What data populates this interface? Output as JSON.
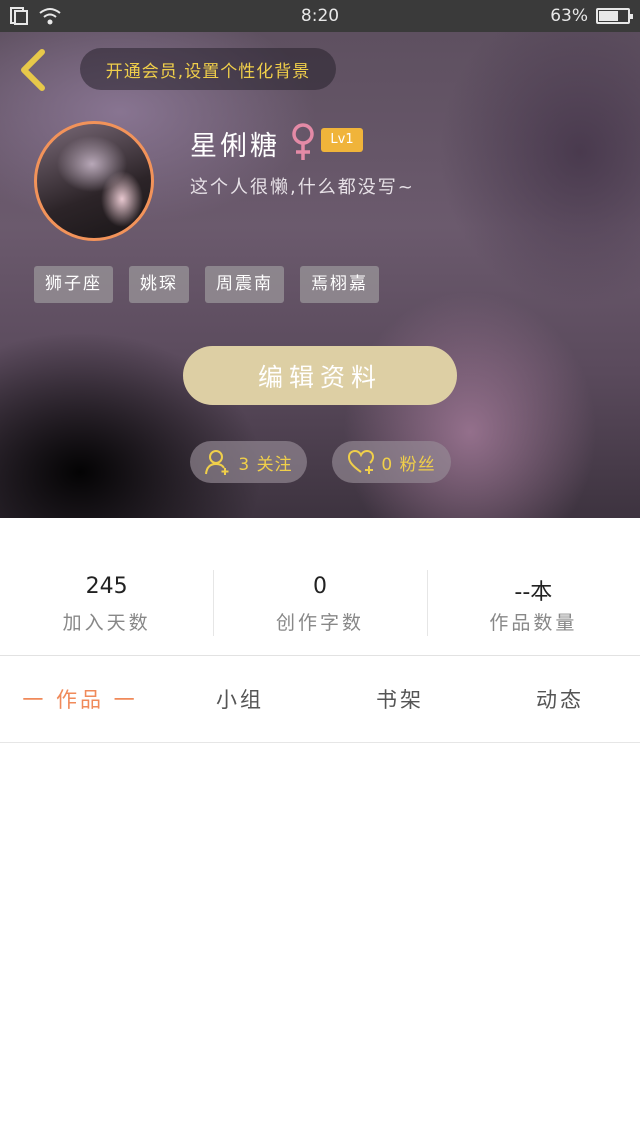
{
  "status_bar": {
    "time": "8:20",
    "battery_percent": "63%",
    "battery_level": 0.63
  },
  "header": {
    "vip_banner": "开通会员,设置个性化背景",
    "username": "星俐糖",
    "gender_symbol": "♀",
    "level": "Lv1",
    "bio": "这个人很懒,什么都没写~",
    "tags": [
      "狮子座",
      "姚琛",
      "周震南",
      "焉栩嘉"
    ],
    "edit_button": "编辑资料",
    "following_label": "3 关注",
    "fans_label": "0 粉丝"
  },
  "stats": [
    {
      "value": "245",
      "label": "加入天数"
    },
    {
      "value": "0",
      "label": "创作字数"
    },
    {
      "value": "--本",
      "label": "作品数量"
    }
  ],
  "tabs": [
    "一 作品 一",
    "小组",
    "书架",
    "动态"
  ],
  "colors": {
    "accent": "#f08a5a",
    "gold": "#f0cf4a",
    "edit_button": "#ddcfa4",
    "level_badge": "#f0b43a",
    "gender": "#e48aa6"
  }
}
